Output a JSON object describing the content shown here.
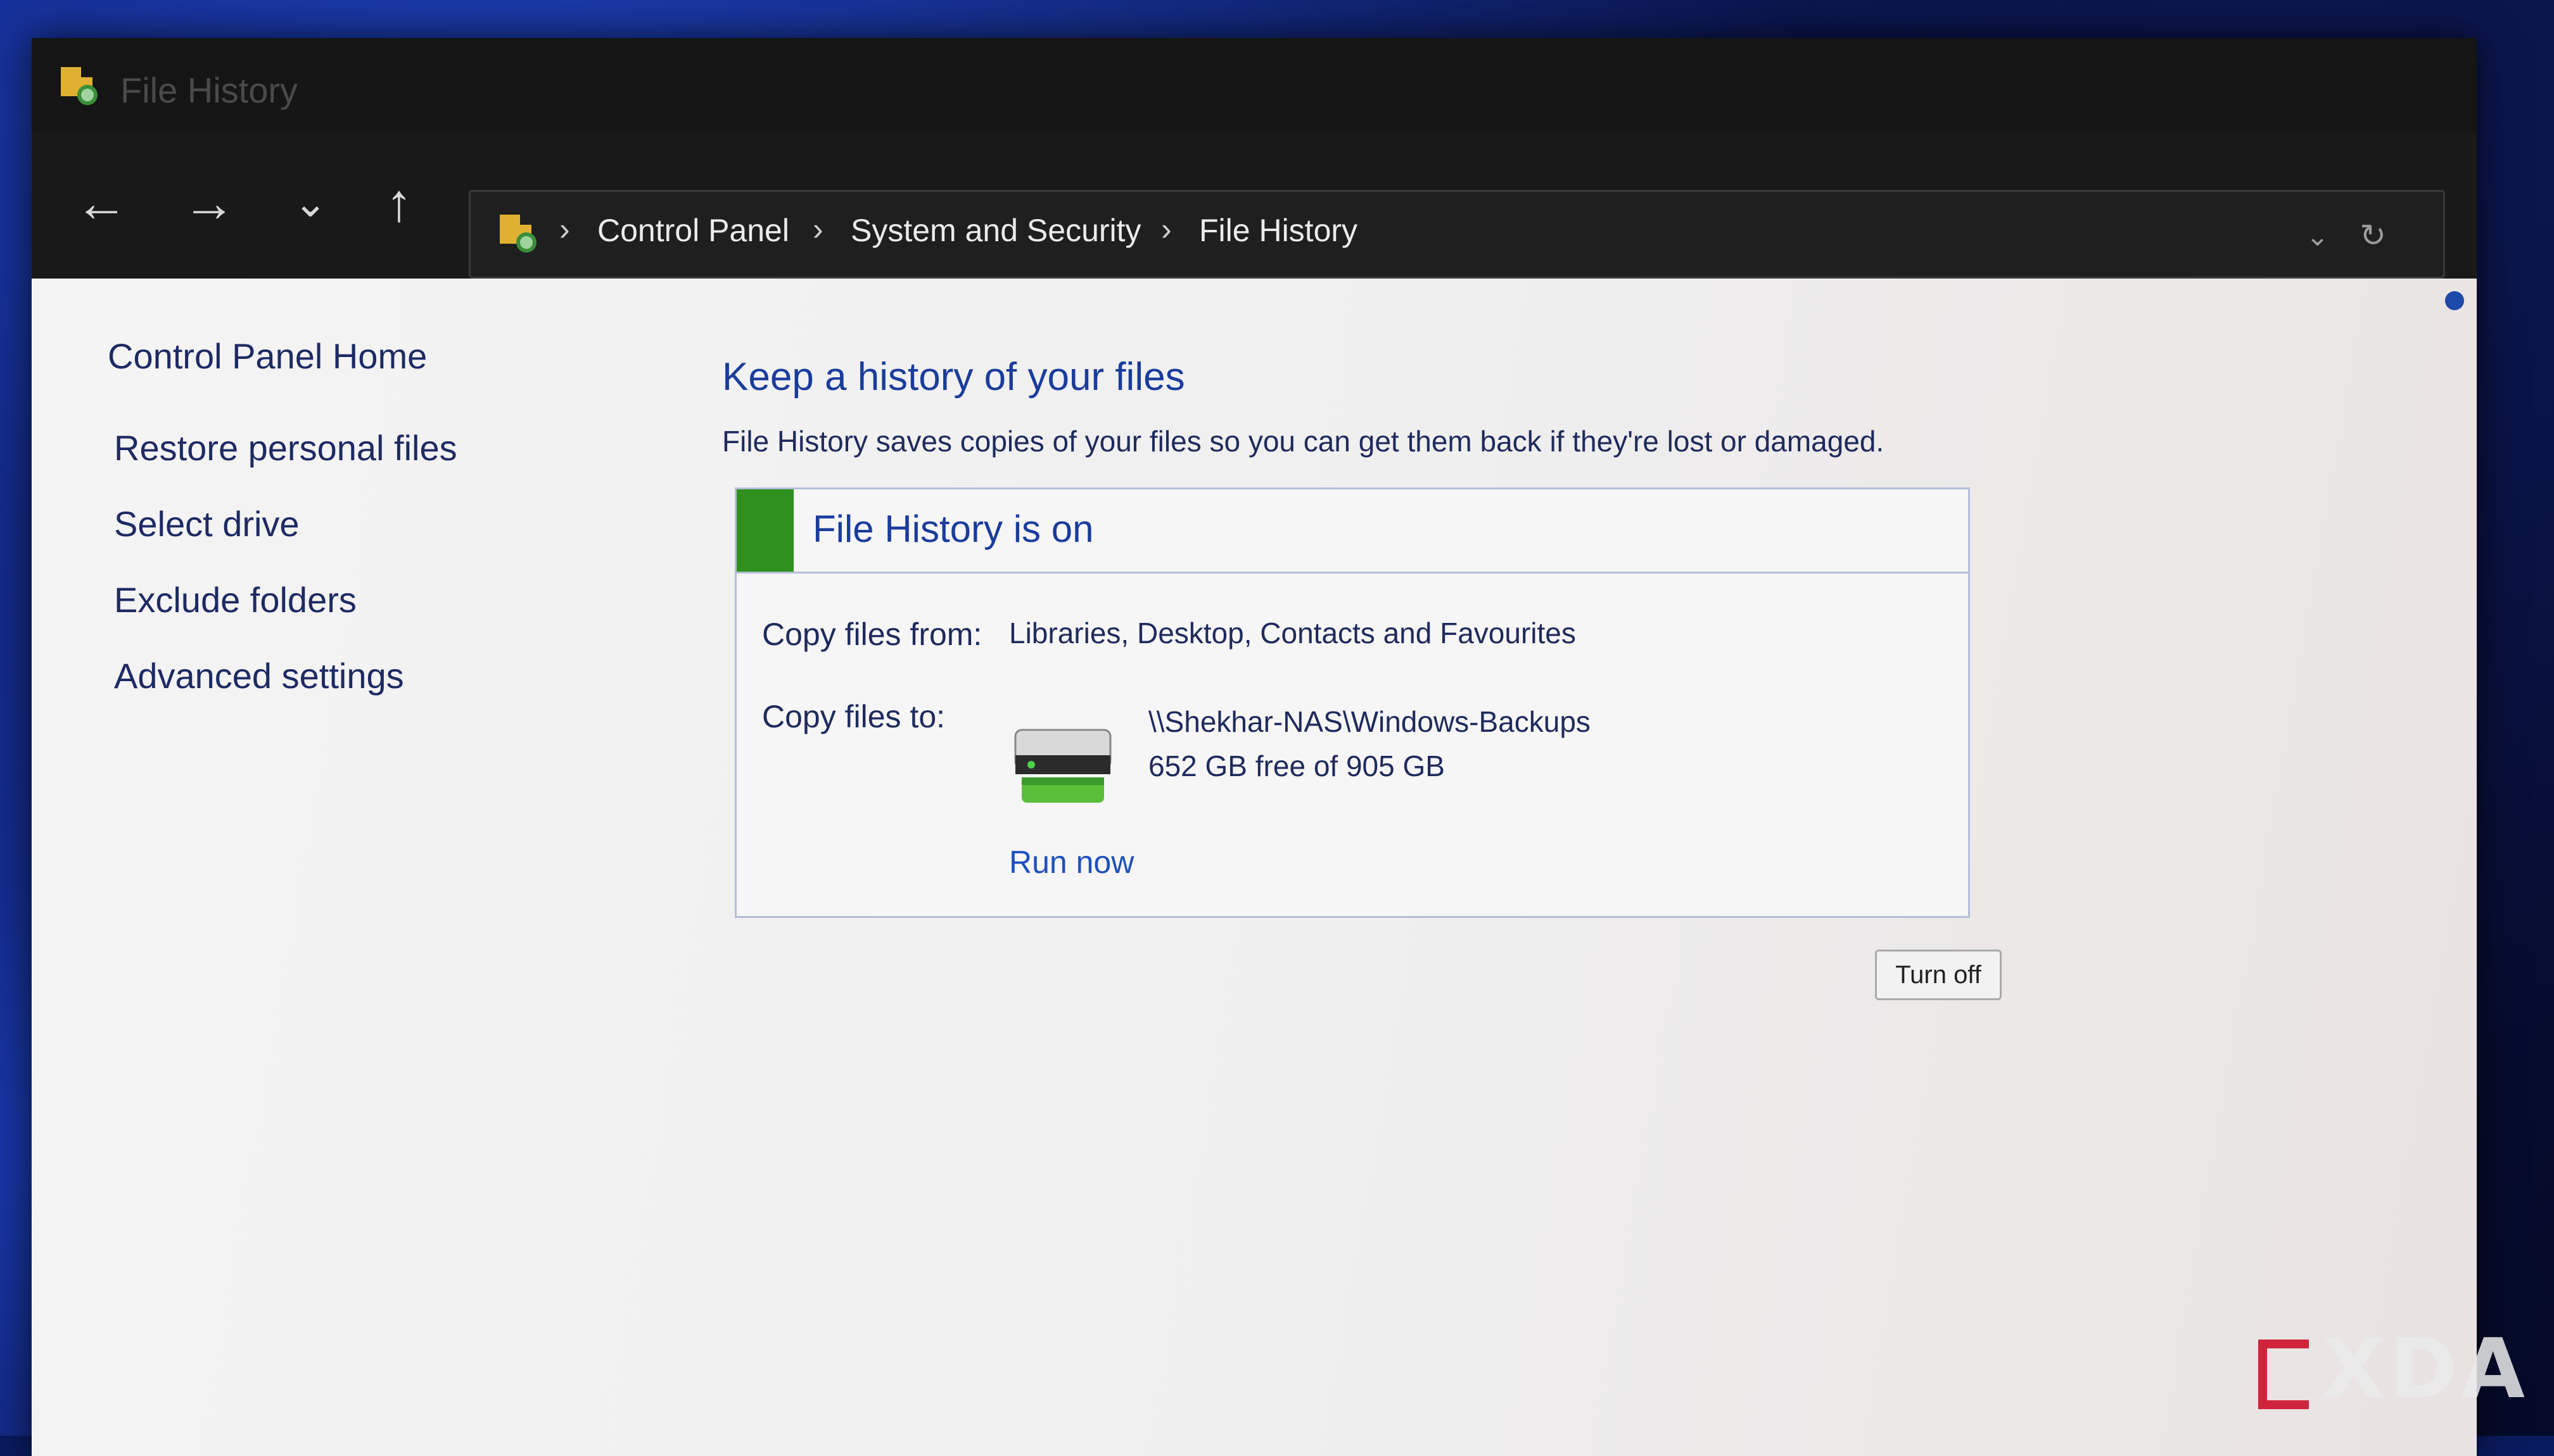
{
  "window": {
    "title": "File History"
  },
  "nav": {
    "back_icon": "back-arrow-icon",
    "forward_icon": "forward-arrow-icon",
    "recent_icon": "chevron-down-icon",
    "up_icon": "up-arrow-icon"
  },
  "address": {
    "crumbs": [
      "Control Panel",
      "System and Security",
      "File History"
    ],
    "separator": "›",
    "dropdown_glyph": "⌄",
    "refresh_glyph": "↻"
  },
  "sidebar": {
    "home": "Control Panel Home",
    "items": [
      {
        "label": "Restore personal files"
      },
      {
        "label": "Select drive"
      },
      {
        "label": "Exclude folders"
      },
      {
        "label": "Advanced settings"
      }
    ]
  },
  "main": {
    "title": "Keep a history of your files",
    "description": "File History saves copies of your files so you can get them back if they're lost or damaged.",
    "status": {
      "title": "File History is on",
      "status_color": "#2f8f1f",
      "copy_from_label": "Copy files from:",
      "copy_from_value": "Libraries, Desktop, Contacts and Favourites",
      "copy_to_label": "Copy files to:",
      "drive_path": "\\\\Shekhar-NAS\\Windows-Backups",
      "drive_space": "652 GB free of 905 GB",
      "run_now": "Run now"
    },
    "turn_off": "Turn off"
  },
  "watermark": {
    "text": "XDA"
  }
}
